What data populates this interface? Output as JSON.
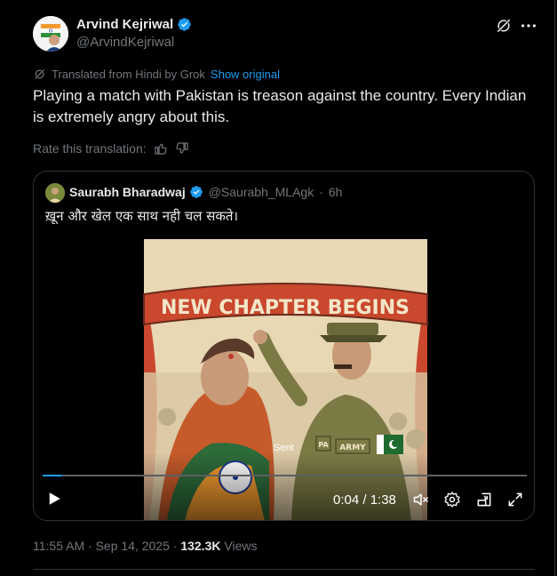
{
  "author": {
    "name": "Arvind Kejriwal",
    "handle": "@ArvindKejriwal"
  },
  "translation": {
    "notice": "Translated from Hindi by Grok",
    "show_original": "Show original",
    "rate_label": "Rate this translation:"
  },
  "tweet": {
    "text": "Playing a match with Pakistan is treason against the country. Every Indian is extremely angry about this."
  },
  "quote": {
    "name": "Saurabh Bharadwaj",
    "handle": "@Saurabh_MLAgk",
    "separator": "·",
    "age": "6h",
    "text": "ख़ून और खेल एक साथ नही चल सकते।"
  },
  "video": {
    "banner": "NEW CHAPTER BEGINS",
    "caption": "Sent",
    "badge_pa": "PA",
    "badge_army": "ARMY",
    "time": "0:04 / 1:38",
    "progress": 0.04
  },
  "meta": {
    "time": "11:55 AM",
    "sep1": "·",
    "date": "Sep 14, 2025",
    "sep2": "·",
    "views_count": "132.3K",
    "views_label": "Views"
  },
  "colors": {
    "accent": "#1d9bf0",
    "muted": "#71767b",
    "text": "#e7e9ea",
    "border": "#2f3336"
  }
}
